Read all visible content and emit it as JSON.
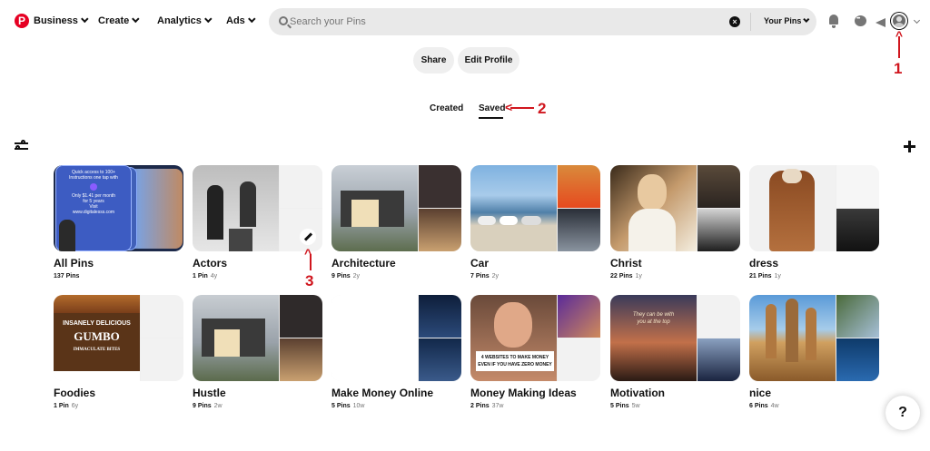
{
  "nav": {
    "logo": "P",
    "business": "Business",
    "create": "Create",
    "analytics": "Analytics",
    "ads": "Ads"
  },
  "search": {
    "placeholder": "Search your Pins",
    "value": "",
    "scope": "Your Pins"
  },
  "profile": {
    "share": "Share",
    "edit_profile": "Edit Profile"
  },
  "tabs": {
    "created": "Created",
    "saved": "Saved",
    "active": "Saved"
  },
  "annotations": {
    "one": "1",
    "two": "2",
    "three": "3"
  },
  "help": {
    "label": "?"
  },
  "colors": {
    "brand": "#e60023",
    "annotation": "#d0161e",
    "button_bg": "#efefef"
  },
  "boards": [
    {
      "name": "All Pins",
      "pins": "137 Pins",
      "age": ""
    },
    {
      "name": "Actors",
      "pins": "1 Pin",
      "age": "4y"
    },
    {
      "name": "Architecture",
      "pins": "9 Pins",
      "age": "2y"
    },
    {
      "name": "Car",
      "pins": "7 Pins",
      "age": "2y"
    },
    {
      "name": "Christ",
      "pins": "22 Pins",
      "age": "1y"
    },
    {
      "name": "dress",
      "pins": "21 Pins",
      "age": "1y"
    },
    {
      "name": "Foodies",
      "pins": "1 Pin",
      "age": "6y"
    },
    {
      "name": "Hustle",
      "pins": "9 Pins",
      "age": "2w"
    },
    {
      "name": "Make Money Online",
      "pins": "5 Pins",
      "age": "10w"
    },
    {
      "name": "Money Making Ideas",
      "pins": "2 Pins",
      "age": "37w"
    },
    {
      "name": "Motivation",
      "pins": "5 Pins",
      "age": "5w"
    },
    {
      "name": "nice",
      "pins": "6 Pins",
      "age": "4w"
    }
  ],
  "cover_text": {
    "all_pins_promo": [
      "Quick access to 100+",
      "Instructions one tap with",
      "Only $1.41 per month",
      "for 5 years",
      "Visit",
      "www.digitalesss.com"
    ],
    "foodies": [
      "INSANELY DELICIOUS",
      "GUMBO",
      "IMMACULATE BITES"
    ],
    "money_making": [
      "4 WEBSITES TO MAKE MONEY",
      "EVEN IF YOU HAVE ZERO MONEY"
    ],
    "motivation": [
      "They can be with",
      "you at the top"
    ]
  }
}
